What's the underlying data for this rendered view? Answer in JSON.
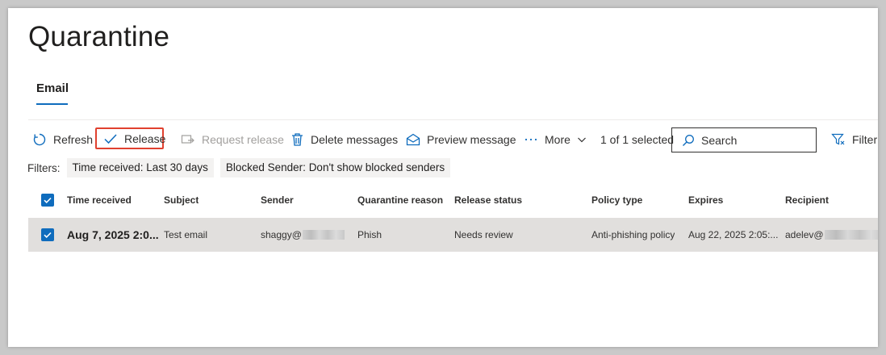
{
  "page": {
    "title": "Quarantine"
  },
  "tabs": [
    {
      "label": "Email"
    }
  ],
  "toolbar": {
    "refresh": "Refresh",
    "release": "Release",
    "request_release": "Request release",
    "delete_messages": "Delete messages",
    "preview_message": "Preview message",
    "more": "More",
    "selection_count": "1 of 1 selected",
    "search_placeholder": "Search",
    "filter": "Filter"
  },
  "filters": {
    "label": "Filters:",
    "chips": [
      {
        "key": "Time received:",
        "value": "Last 30 days"
      },
      {
        "key": "Blocked Sender:",
        "value": "Don't show blocked senders"
      }
    ]
  },
  "table": {
    "columns": [
      "Time received",
      "Subject",
      "Sender",
      "Quarantine reason",
      "Release status",
      "Policy type",
      "Expires",
      "Recipient"
    ],
    "rows": [
      {
        "selected": true,
        "time_received": "Aug 7, 2025 2:0...",
        "subject": "Test email",
        "sender": "shaggy@",
        "quarantine_reason": "Phish",
        "release_status": "Needs review",
        "policy_type": "Anti-phishing policy",
        "expires": "Aug 22, 2025 2:05:...",
        "recipient": "adelev@"
      }
    ]
  },
  "colors": {
    "accent": "#0f6cbd",
    "highlight_border": "#e0412f",
    "selected_row": "#e1dfdd"
  }
}
